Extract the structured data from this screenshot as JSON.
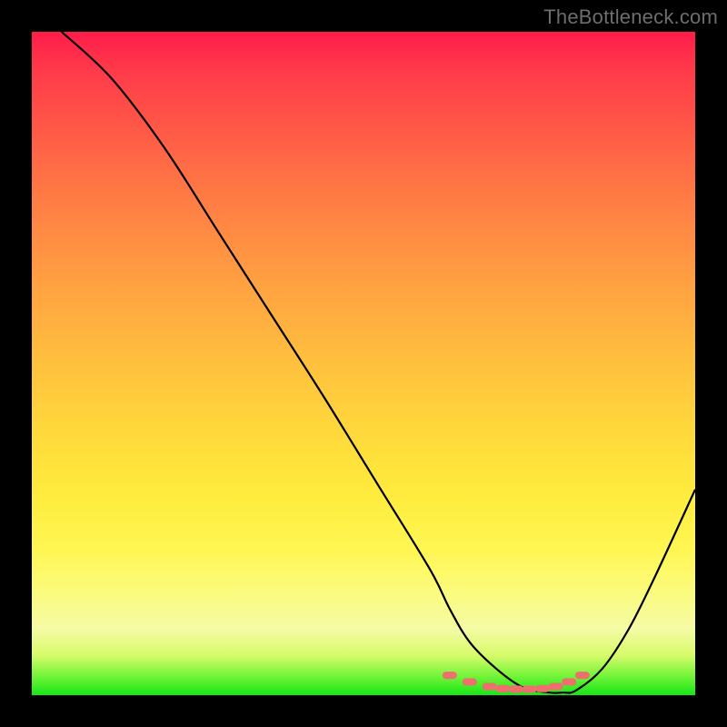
{
  "watermark": "TheBottleneck.com",
  "chart_data": {
    "type": "line",
    "title": "",
    "xlabel": "",
    "ylabel": "",
    "xlim": [
      0,
      100
    ],
    "ylim": [
      0,
      100
    ],
    "grid": false,
    "series": [
      {
        "name": "curve",
        "color": "#000000",
        "x": [
          4.5,
          12,
          20,
          28,
          36,
          44,
          52,
          60,
          63,
          66,
          70,
          74,
          78,
          80,
          82,
          86,
          90,
          94,
          100
        ],
        "y": [
          100,
          93,
          82.5,
          70,
          57.5,
          45,
          32,
          19,
          13,
          8,
          4,
          1.2,
          0.4,
          0.4,
          0.7,
          4,
          10,
          18,
          31
        ]
      }
    ],
    "markers": {
      "name": "dotted-bottom",
      "color": "#ef6e6e",
      "shape": "rounded-pill",
      "x": [
        63,
        66,
        69,
        71,
        73,
        75,
        77,
        79,
        81,
        83
      ],
      "y": [
        3.0,
        2.0,
        1.3,
        1.0,
        0.9,
        0.9,
        1.0,
        1.3,
        2.0,
        3.0
      ]
    },
    "background_gradient": {
      "top": "#ff1c4a",
      "mid": "#ffd53d",
      "bottom": "#17e617"
    }
  }
}
